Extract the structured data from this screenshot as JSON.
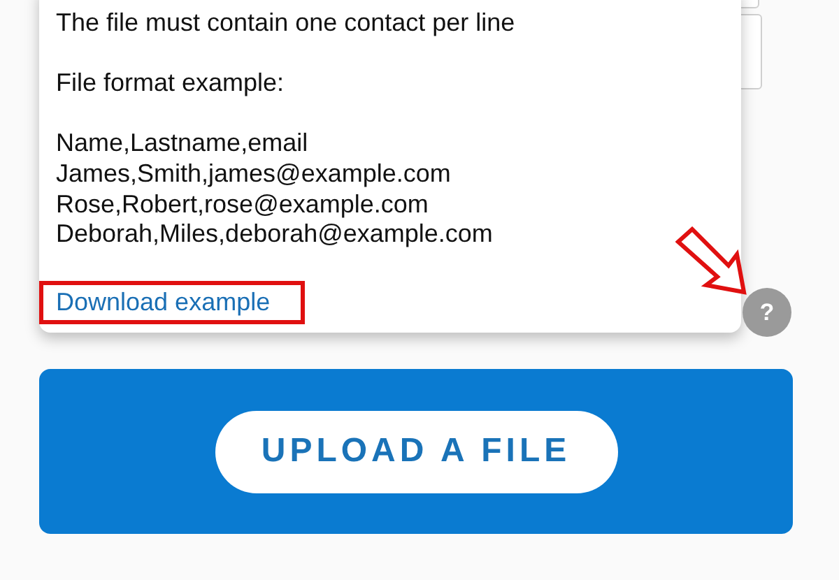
{
  "popover": {
    "intro": "The file must contain one contact per line",
    "format_label": "File format example:",
    "example_lines": [
      "Name,Lastname,email",
      "James,Smith,james@example.com",
      "Rose,Robert,rose@example.com",
      "Deborah,Miles,deborah@example.com"
    ],
    "link": "Download example"
  },
  "help_button": {
    "label": "?"
  },
  "upload_button": {
    "label": "UPLOAD A FILE"
  }
}
